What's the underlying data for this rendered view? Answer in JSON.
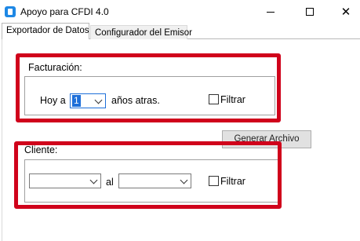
{
  "window": {
    "title": "Apoyo para CFDI 4.0",
    "minimize_icon": "minimize-icon",
    "maximize_icon": "maximize-icon",
    "close_glyph": "✕"
  },
  "tabs": [
    {
      "label": "Exportador de Datos",
      "active": true
    },
    {
      "label": "Configurador del Emisor",
      "active": false
    }
  ],
  "facturacion": {
    "group_label": "Facturación:",
    "prefix": "Hoy a",
    "years_value": "1",
    "suffix": "años atras.",
    "filter_label": "Filtrar",
    "filter_checked": false
  },
  "generate_button": "Generar Archivo",
  "cliente": {
    "group_label": "Cliente:",
    "from_value": "",
    "connector": "al",
    "to_value": "",
    "filter_label": "Filtrar",
    "filter_checked": false
  },
  "colors": {
    "highlight_red": "#d0021b",
    "selection_blue": "#1e6fd9"
  }
}
